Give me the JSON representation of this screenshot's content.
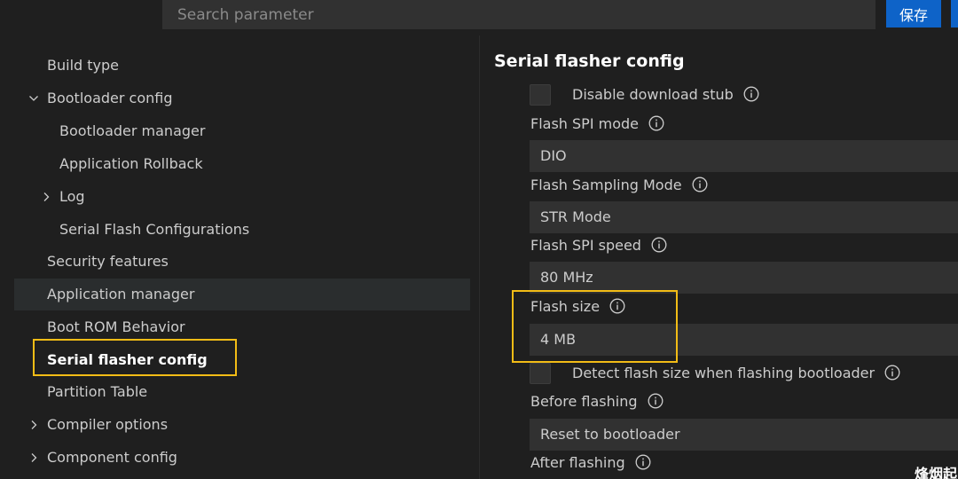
{
  "header": {
    "search_placeholder": "Search parameter",
    "save_label": "保存"
  },
  "sidebar": {
    "items": [
      {
        "label": "Build type",
        "level": 0,
        "expander": "none"
      },
      {
        "label": "Bootloader config",
        "level": 0,
        "expander": "expanded"
      },
      {
        "label": "Bootloader manager",
        "level": 1,
        "expander": "none"
      },
      {
        "label": "Application Rollback",
        "level": 1,
        "expander": "none"
      },
      {
        "label": "Log",
        "level": 1,
        "expander": "collapsed"
      },
      {
        "label": "Serial Flash Configurations",
        "level": 1,
        "expander": "none"
      },
      {
        "label": "Security features",
        "level": 0,
        "expander": "none"
      },
      {
        "label": "Application manager",
        "level": 0,
        "expander": "none",
        "selected": true
      },
      {
        "label": "Boot ROM Behavior",
        "level": 0,
        "expander": "none"
      },
      {
        "label": "Serial flasher config",
        "level": 0,
        "expander": "none",
        "active": true
      },
      {
        "label": "Partition Table",
        "level": 0,
        "expander": "none"
      },
      {
        "label": "Compiler options",
        "level": 0,
        "expander": "collapsed"
      },
      {
        "label": "Component config",
        "level": 0,
        "expander": "collapsed"
      }
    ]
  },
  "content": {
    "title": "Serial flasher config",
    "disable_download_stub": {
      "label": "Disable download stub",
      "checked": false
    },
    "flash_spi_mode": {
      "label": "Flash SPI mode",
      "value": "DIO"
    },
    "flash_sampling_mode": {
      "label": "Flash Sampling Mode",
      "value": "STR Mode"
    },
    "flash_spi_speed": {
      "label": "Flash SPI speed",
      "value": "80 MHz"
    },
    "flash_size": {
      "label": "Flash size",
      "value": "4 MB"
    },
    "detect_flash_size": {
      "label": "Detect flash size when flashing bootloader",
      "checked": false
    },
    "before_flashing": {
      "label": "Before flashing",
      "value": "Reset to bootloader"
    },
    "after_flashing": {
      "label": "After flashing"
    }
  },
  "watermark": "烽烟起",
  "colors": {
    "background": "#1f1f1f",
    "input_background": "#313131",
    "accent_blue": "#0e63c8",
    "highlight_yellow": "#f2bc16",
    "selected_row": "#2a2d2e"
  }
}
